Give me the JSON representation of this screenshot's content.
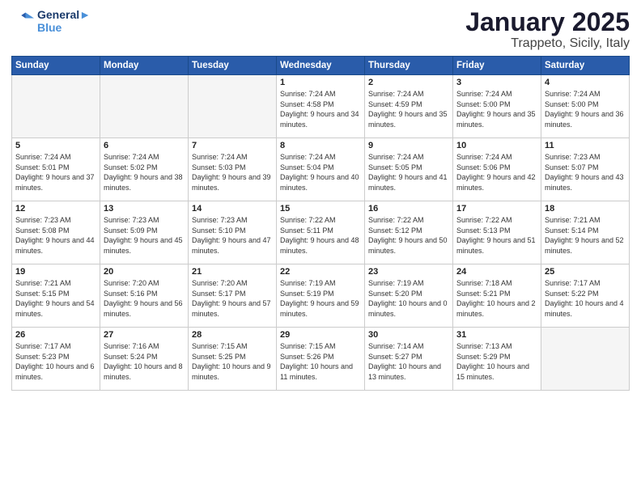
{
  "header": {
    "logo_line1": "General",
    "logo_line2": "Blue",
    "title": "January 2025",
    "subtitle": "Trappeto, Sicily, Italy"
  },
  "weekdays": [
    "Sunday",
    "Monday",
    "Tuesday",
    "Wednesday",
    "Thursday",
    "Friday",
    "Saturday"
  ],
  "weeks": [
    [
      {
        "day": "",
        "sunrise": "",
        "sunset": "",
        "daylight": ""
      },
      {
        "day": "",
        "sunrise": "",
        "sunset": "",
        "daylight": ""
      },
      {
        "day": "",
        "sunrise": "",
        "sunset": "",
        "daylight": ""
      },
      {
        "day": "1",
        "sunrise": "Sunrise: 7:24 AM",
        "sunset": "Sunset: 4:58 PM",
        "daylight": "Daylight: 9 hours and 34 minutes."
      },
      {
        "day": "2",
        "sunrise": "Sunrise: 7:24 AM",
        "sunset": "Sunset: 4:59 PM",
        "daylight": "Daylight: 9 hours and 35 minutes."
      },
      {
        "day": "3",
        "sunrise": "Sunrise: 7:24 AM",
        "sunset": "Sunset: 5:00 PM",
        "daylight": "Daylight: 9 hours and 35 minutes."
      },
      {
        "day": "4",
        "sunrise": "Sunrise: 7:24 AM",
        "sunset": "Sunset: 5:00 PM",
        "daylight": "Daylight: 9 hours and 36 minutes."
      }
    ],
    [
      {
        "day": "5",
        "sunrise": "Sunrise: 7:24 AM",
        "sunset": "Sunset: 5:01 PM",
        "daylight": "Daylight: 9 hours and 37 minutes."
      },
      {
        "day": "6",
        "sunrise": "Sunrise: 7:24 AM",
        "sunset": "Sunset: 5:02 PM",
        "daylight": "Daylight: 9 hours and 38 minutes."
      },
      {
        "day": "7",
        "sunrise": "Sunrise: 7:24 AM",
        "sunset": "Sunset: 5:03 PM",
        "daylight": "Daylight: 9 hours and 39 minutes."
      },
      {
        "day": "8",
        "sunrise": "Sunrise: 7:24 AM",
        "sunset": "Sunset: 5:04 PM",
        "daylight": "Daylight: 9 hours and 40 minutes."
      },
      {
        "day": "9",
        "sunrise": "Sunrise: 7:24 AM",
        "sunset": "Sunset: 5:05 PM",
        "daylight": "Daylight: 9 hours and 41 minutes."
      },
      {
        "day": "10",
        "sunrise": "Sunrise: 7:24 AM",
        "sunset": "Sunset: 5:06 PM",
        "daylight": "Daylight: 9 hours and 42 minutes."
      },
      {
        "day": "11",
        "sunrise": "Sunrise: 7:23 AM",
        "sunset": "Sunset: 5:07 PM",
        "daylight": "Daylight: 9 hours and 43 minutes."
      }
    ],
    [
      {
        "day": "12",
        "sunrise": "Sunrise: 7:23 AM",
        "sunset": "Sunset: 5:08 PM",
        "daylight": "Daylight: 9 hours and 44 minutes."
      },
      {
        "day": "13",
        "sunrise": "Sunrise: 7:23 AM",
        "sunset": "Sunset: 5:09 PM",
        "daylight": "Daylight: 9 hours and 45 minutes."
      },
      {
        "day": "14",
        "sunrise": "Sunrise: 7:23 AM",
        "sunset": "Sunset: 5:10 PM",
        "daylight": "Daylight: 9 hours and 47 minutes."
      },
      {
        "day": "15",
        "sunrise": "Sunrise: 7:22 AM",
        "sunset": "Sunset: 5:11 PM",
        "daylight": "Daylight: 9 hours and 48 minutes."
      },
      {
        "day": "16",
        "sunrise": "Sunrise: 7:22 AM",
        "sunset": "Sunset: 5:12 PM",
        "daylight": "Daylight: 9 hours and 50 minutes."
      },
      {
        "day": "17",
        "sunrise": "Sunrise: 7:22 AM",
        "sunset": "Sunset: 5:13 PM",
        "daylight": "Daylight: 9 hours and 51 minutes."
      },
      {
        "day": "18",
        "sunrise": "Sunrise: 7:21 AM",
        "sunset": "Sunset: 5:14 PM",
        "daylight": "Daylight: 9 hours and 52 minutes."
      }
    ],
    [
      {
        "day": "19",
        "sunrise": "Sunrise: 7:21 AM",
        "sunset": "Sunset: 5:15 PM",
        "daylight": "Daylight: 9 hours and 54 minutes."
      },
      {
        "day": "20",
        "sunrise": "Sunrise: 7:20 AM",
        "sunset": "Sunset: 5:16 PM",
        "daylight": "Daylight: 9 hours and 56 minutes."
      },
      {
        "day": "21",
        "sunrise": "Sunrise: 7:20 AM",
        "sunset": "Sunset: 5:17 PM",
        "daylight": "Daylight: 9 hours and 57 minutes."
      },
      {
        "day": "22",
        "sunrise": "Sunrise: 7:19 AM",
        "sunset": "Sunset: 5:19 PM",
        "daylight": "Daylight: 9 hours and 59 minutes."
      },
      {
        "day": "23",
        "sunrise": "Sunrise: 7:19 AM",
        "sunset": "Sunset: 5:20 PM",
        "daylight": "Daylight: 10 hours and 0 minutes."
      },
      {
        "day": "24",
        "sunrise": "Sunrise: 7:18 AM",
        "sunset": "Sunset: 5:21 PM",
        "daylight": "Daylight: 10 hours and 2 minutes."
      },
      {
        "day": "25",
        "sunrise": "Sunrise: 7:17 AM",
        "sunset": "Sunset: 5:22 PM",
        "daylight": "Daylight: 10 hours and 4 minutes."
      }
    ],
    [
      {
        "day": "26",
        "sunrise": "Sunrise: 7:17 AM",
        "sunset": "Sunset: 5:23 PM",
        "daylight": "Daylight: 10 hours and 6 minutes."
      },
      {
        "day": "27",
        "sunrise": "Sunrise: 7:16 AM",
        "sunset": "Sunset: 5:24 PM",
        "daylight": "Daylight: 10 hours and 8 minutes."
      },
      {
        "day": "28",
        "sunrise": "Sunrise: 7:15 AM",
        "sunset": "Sunset: 5:25 PM",
        "daylight": "Daylight: 10 hours and 9 minutes."
      },
      {
        "day": "29",
        "sunrise": "Sunrise: 7:15 AM",
        "sunset": "Sunset: 5:26 PM",
        "daylight": "Daylight: 10 hours and 11 minutes."
      },
      {
        "day": "30",
        "sunrise": "Sunrise: 7:14 AM",
        "sunset": "Sunset: 5:27 PM",
        "daylight": "Daylight: 10 hours and 13 minutes."
      },
      {
        "day": "31",
        "sunrise": "Sunrise: 7:13 AM",
        "sunset": "Sunset: 5:29 PM",
        "daylight": "Daylight: 10 hours and 15 minutes."
      },
      {
        "day": "",
        "sunrise": "",
        "sunset": "",
        "daylight": ""
      }
    ]
  ]
}
